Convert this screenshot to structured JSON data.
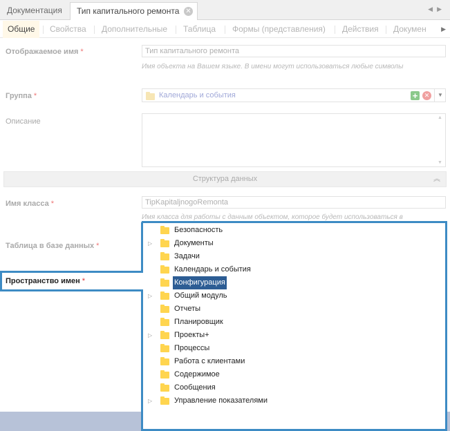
{
  "doc_tabs": [
    {
      "label": "Документация"
    },
    {
      "label": "Тип капитального ремонта"
    }
  ],
  "section_tabs": [
    "Общие",
    "Свойства",
    "Дополнительные",
    "Таблица",
    "Формы (представления)",
    "Действия",
    "Докумен"
  ],
  "form": {
    "display_name_label": "Отображаемое имя",
    "display_name_value": "Тип капитального ремонта",
    "display_name_hint": "Имя объекта на Вашем языке. В имени могут использоваться любые символы",
    "group_label": "Группа",
    "group_value": "Календарь и события",
    "description_label": "Описание",
    "section_title": "Структура данных",
    "class_name_label": "Имя класса",
    "class_name_value": "TipKapitaljnogoRemonta",
    "class_name_hint": "Имя класса для работы с данным объектом, которое будет использоваться в",
    "db_table_label": "Таблица в базе данных",
    "namespace_label": "Пространство имен",
    "required_mark": "*"
  },
  "tree": [
    {
      "label": "Безопасность",
      "expandable": false
    },
    {
      "label": "Документы",
      "expandable": true
    },
    {
      "label": "Задачи",
      "expandable": false
    },
    {
      "label": "Календарь и события",
      "expandable": false
    },
    {
      "label": "Конфигурация",
      "expandable": false,
      "selected": true
    },
    {
      "label": "Общий модуль",
      "expandable": true
    },
    {
      "label": "Отчеты",
      "expandable": false
    },
    {
      "label": "Планировщик",
      "expandable": false
    },
    {
      "label": "Проекты+",
      "expandable": true
    },
    {
      "label": "Процессы",
      "expandable": false
    },
    {
      "label": "Работа с клиентами",
      "expandable": false
    },
    {
      "label": "Содержимое",
      "expandable": false
    },
    {
      "label": "Сообщения",
      "expandable": false
    },
    {
      "label": "Управление показателями",
      "expandable": true
    }
  ],
  "icons": {
    "close": "close-icon",
    "folder": "folder-icon",
    "expand": "triangle-right-icon",
    "add": "plus-icon",
    "clear": "clear-icon",
    "dropdown": "chevron-down-icon",
    "collapse": "double-chevron-up-icon"
  },
  "colors": {
    "highlight_outline": "#3d8bc4",
    "selection": "#2d5d94",
    "folder": "#ffd54f",
    "bottom_bar": "#b7c2d8"
  }
}
